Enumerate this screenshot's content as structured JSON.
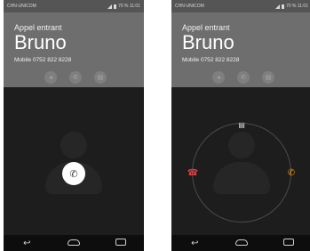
{
  "screens": [
    {
      "status": {
        "carrier": "CHN-UNICOM",
        "right": "70 % 11:01"
      },
      "call": {
        "label": "Appel entrant",
        "name": "Bruno",
        "number": "Mobile 0752 822 8228"
      },
      "actions": [
        "volume-icon",
        "phone-icon",
        "message-icon"
      ],
      "mode": "idle"
    },
    {
      "status": {
        "carrier": "CHN-UNICOM",
        "right": "70 % 11:01"
      },
      "call": {
        "label": "Appel entrant",
        "name": "Bruno",
        "number": "Mobile 0752 822 8228"
      },
      "actions": [
        "volume-icon",
        "phone-icon",
        "message-icon"
      ],
      "mode": "dragging"
    }
  ],
  "colors": {
    "decline": "#e63b3b",
    "accept": "#f29a1d",
    "header": "#6e6e6e",
    "background": "#1d1d1d"
  }
}
